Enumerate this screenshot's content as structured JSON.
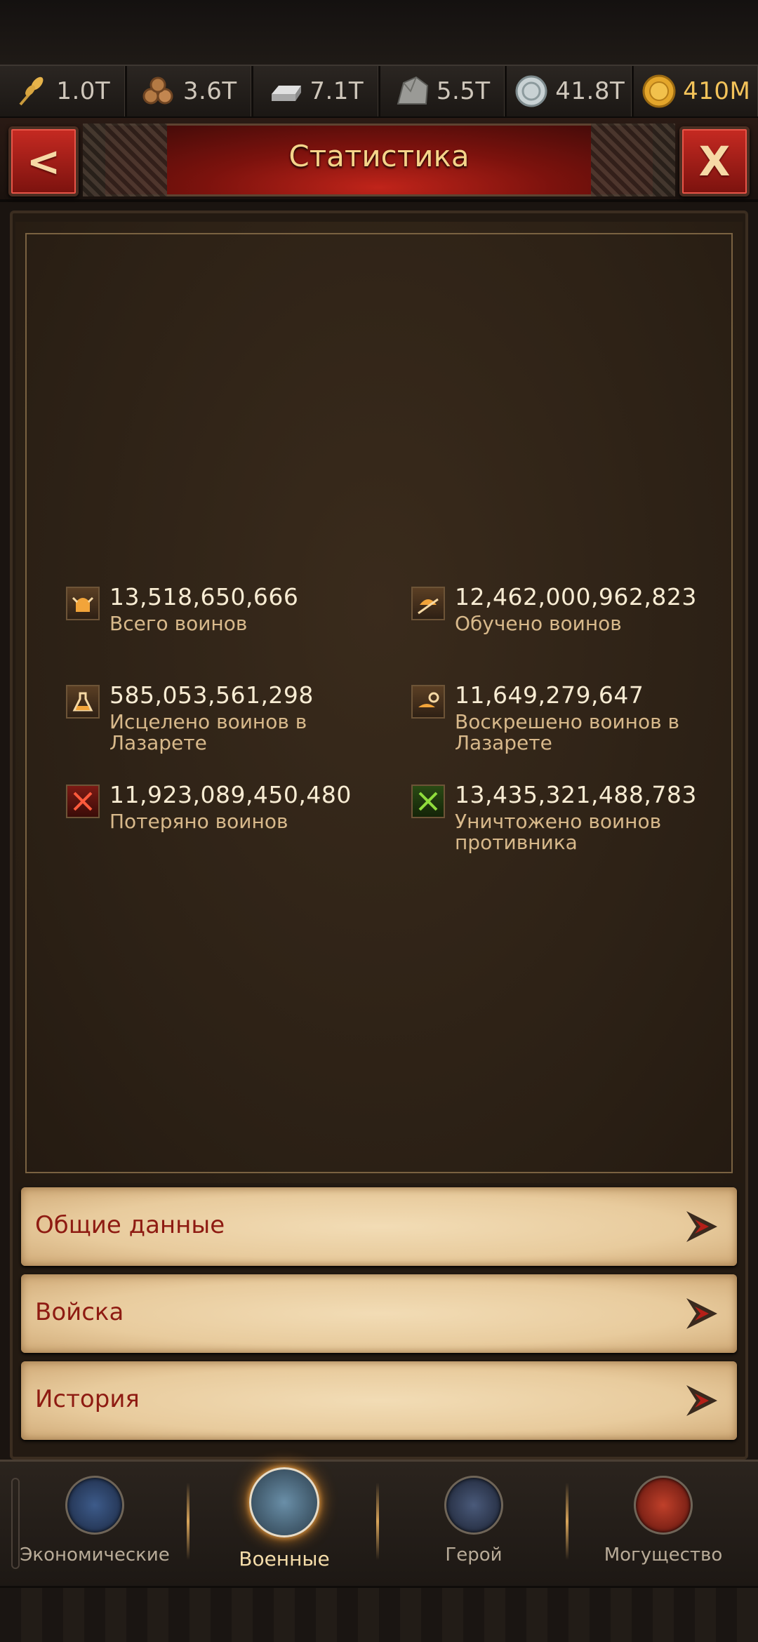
{
  "resources": [
    {
      "name": "wheat-icon",
      "value": "1.0T"
    },
    {
      "name": "wood-icon",
      "value": "3.6T"
    },
    {
      "name": "iron-icon",
      "value": "7.1T"
    },
    {
      "name": "stone-icon",
      "value": "5.5T"
    },
    {
      "name": "silver-icon",
      "value": "41.8T"
    },
    {
      "name": "gold-icon",
      "value": "410M"
    }
  ],
  "header": {
    "title": "Статистика",
    "back_label": "<",
    "close_label": "X"
  },
  "stats": [
    {
      "value": "13,518,650,666",
      "label": "Всего воинов",
      "icon": "warrior-helmet-icon"
    },
    {
      "value": "12,462,000,962,823",
      "label": "Обучено воинов",
      "icon": "trained-warrior-icon"
    },
    {
      "value": "585,053,561,298",
      "label": "Исцелено воинов в Лазарете",
      "icon": "healing-potion-icon"
    },
    {
      "value": "11,649,279,647",
      "label": "Воскрешено воинов в Лазарете",
      "icon": "revive-potion-icon"
    },
    {
      "value": "11,923,089,450,480",
      "label": "Потеряно воинов",
      "icon": "lost-swords-icon"
    },
    {
      "value": "13,435,321,488,783",
      "label": "Уничтожено воинов противника",
      "icon": "destroyed-swords-icon"
    }
  ],
  "rows": [
    {
      "label": "Общие данные"
    },
    {
      "label": "Войска"
    },
    {
      "label": "История"
    }
  ],
  "nav": [
    {
      "label": "Экономические",
      "active": false
    },
    {
      "label": "Военные",
      "active": true
    },
    {
      "label": "Герой",
      "active": false
    },
    {
      "label": "Могущество",
      "active": false
    }
  ],
  "colors": {
    "accent_red": "#8e1b12",
    "gold_text": "#f3c35a",
    "title": "#f5d48a"
  }
}
